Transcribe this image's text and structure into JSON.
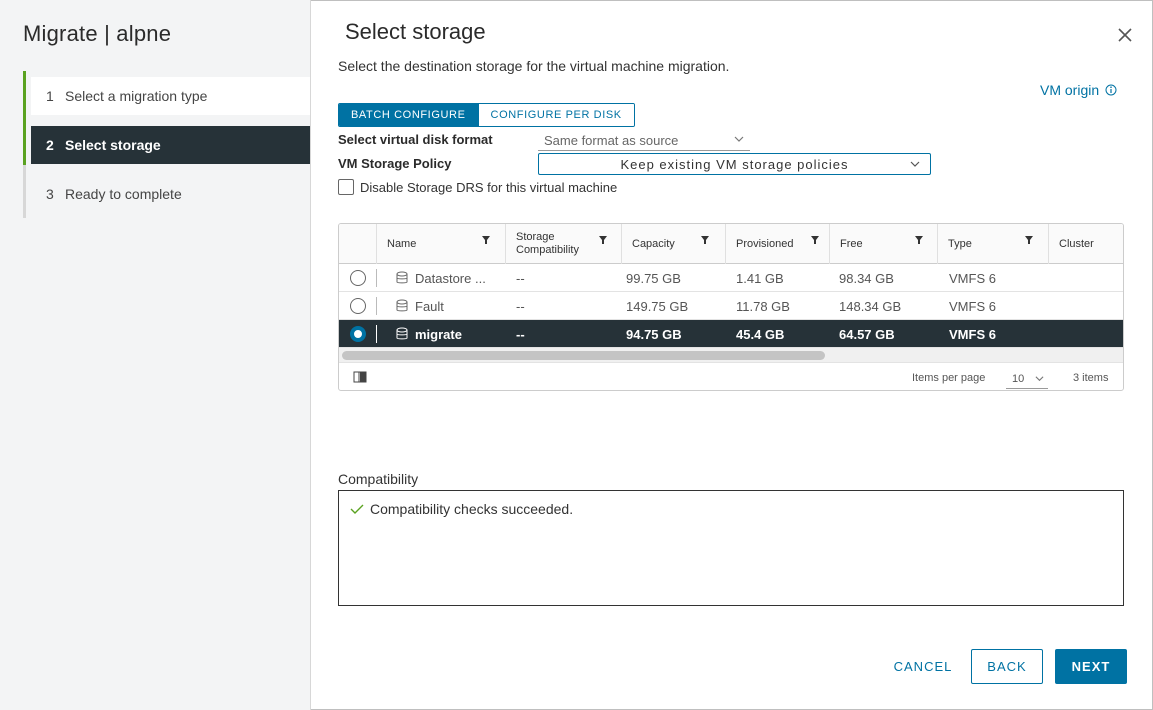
{
  "wizard": {
    "title": "Migrate | alpne",
    "steps": [
      {
        "num": "1",
        "label": "Select a migration type"
      },
      {
        "num": "2",
        "label": "Select storage"
      },
      {
        "num": "3",
        "label": "Ready to complete"
      }
    ]
  },
  "page": {
    "title": "Select storage",
    "subtitle": "Select the destination storage for the virtual machine migration.",
    "vm_origin": "VM origin"
  },
  "tabs": {
    "batch": "BATCH CONFIGURE",
    "per_disk": "CONFIGURE PER DISK"
  },
  "form": {
    "disk_format_label": "Select virtual disk format",
    "disk_format_value": "Same format as source",
    "policy_label": "VM Storage Policy",
    "policy_value": "Keep existing VM storage policies",
    "drs_label": "Disable Storage DRS for this virtual machine"
  },
  "grid": {
    "columns": {
      "name": "Name",
      "compat_line1": "Storage",
      "compat_line2": "Compatibility",
      "capacity": "Capacity",
      "provisioned": "Provisioned",
      "free": "Free",
      "type": "Type",
      "cluster": "Cluster"
    },
    "rows": [
      {
        "name": "Datastore ...",
        "compat": "--",
        "capacity": "99.75 GB",
        "provisioned": "1.41 GB",
        "free": "98.34 GB",
        "type": "VMFS 6"
      },
      {
        "name": "Fault",
        "compat": "--",
        "capacity": "149.75 GB",
        "provisioned": "11.78 GB",
        "free": "148.34 GB",
        "type": "VMFS 6"
      },
      {
        "name": "migrate",
        "compat": "--",
        "capacity": "94.75 GB",
        "provisioned": "45.4 GB",
        "free": "64.57 GB",
        "type": "VMFS 6"
      }
    ],
    "items_per_page_label": "Items per page",
    "items_per_page_value": "10",
    "item_count": "3 items"
  },
  "compatibility": {
    "label": "Compatibility",
    "message": "Compatibility checks succeeded."
  },
  "buttons": {
    "cancel": "CANCEL",
    "back": "BACK",
    "next": "NEXT"
  },
  "colors": {
    "accent": "#0072a3",
    "selected_row": "#263238",
    "success": "#5aa220"
  }
}
